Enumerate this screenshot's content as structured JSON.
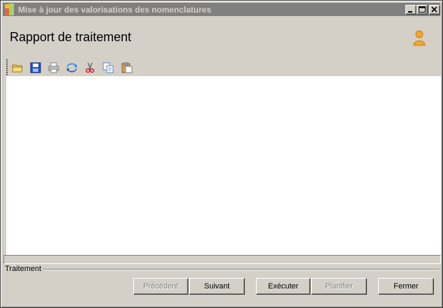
{
  "window": {
    "title": "Mise à jour des valorisations des nomenclatures",
    "controls": {
      "minimize": "minimize-icon",
      "maximize": "maximize-icon",
      "close": "close-icon"
    }
  },
  "header": {
    "title": "Rapport de traitement",
    "icon": "user-icon"
  },
  "toolbar": {
    "items": [
      {
        "name": "open",
        "icon": "folder-icon"
      },
      {
        "name": "save",
        "icon": "save-icon"
      },
      {
        "name": "print",
        "icon": "print-icon"
      },
      {
        "name": "refresh",
        "icon": "refresh-icon"
      },
      {
        "name": "cut",
        "icon": "cut-icon"
      },
      {
        "name": "copy",
        "icon": "copy-icon"
      },
      {
        "name": "paste",
        "icon": "paste-icon"
      }
    ]
  },
  "report": {
    "content": ""
  },
  "footer": {
    "group_label": "Traitement",
    "buttons": {
      "previous": {
        "label": "Précédent",
        "enabled": false
      },
      "next": {
        "label": "Suivant",
        "enabled": true
      },
      "execute": {
        "label": "Exécuter",
        "enabled": true
      },
      "schedule": {
        "label": "Planifier",
        "enabled": false
      },
      "close": {
        "label": "Fermer",
        "enabled": true
      }
    }
  },
  "colors": {
    "window_bg": "#d4d0c8",
    "titlebar_inactive": "#808080",
    "report_bg": "#ffffff"
  }
}
